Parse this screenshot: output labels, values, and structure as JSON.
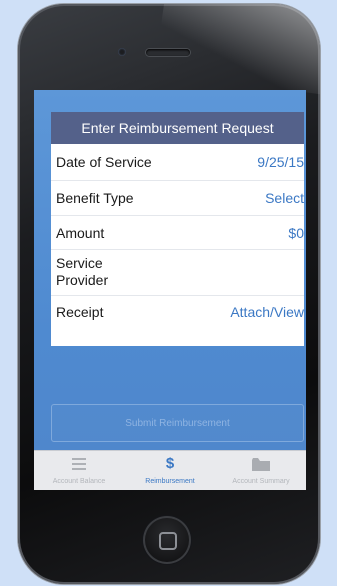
{
  "header": {
    "title": "Enter Reimbursement Request"
  },
  "form": {
    "rows": [
      {
        "label": "Date of Service",
        "value": "9/25/15"
      },
      {
        "label": "Benefit Type",
        "value": "Select"
      },
      {
        "label": "Amount",
        "value": "$0"
      },
      {
        "label": "Service Provider",
        "label_line1": "Service",
        "label_line2": "Provider",
        "value": ""
      },
      {
        "label": "Receipt",
        "value": "Attach/View"
      }
    ]
  },
  "submit": {
    "label": "Submit Reimbursement"
  },
  "tabs": [
    {
      "label": "Account Balance",
      "icon": "list-icon",
      "active": false
    },
    {
      "label": "Reimbursement",
      "icon": "dollar-icon",
      "active": true,
      "glyph": "$"
    },
    {
      "label": "Account Summary",
      "icon": "folder-icon",
      "active": false
    }
  ],
  "colors": {
    "accent": "#3b78c4",
    "header_bar": "#54618a",
    "screen_bg": "#5d97d8",
    "tab_active": "#3b78c4",
    "tab_inactive": "#b3b6bb"
  }
}
